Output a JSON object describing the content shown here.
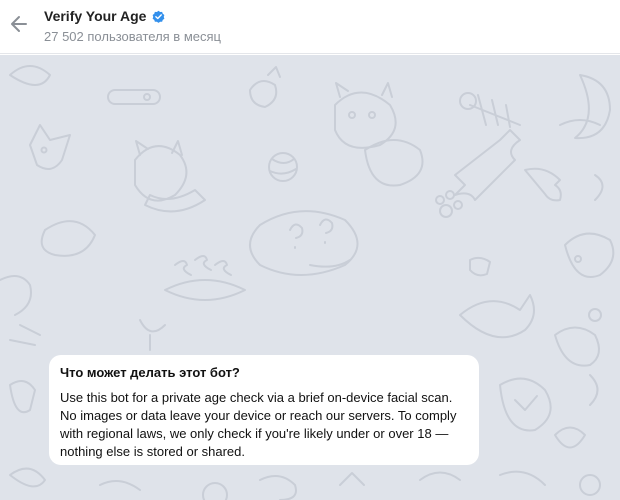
{
  "header": {
    "title": "Verify Your Age",
    "subtitle": "27 502 пользователя в месяц",
    "back_icon": "arrow-left-icon",
    "verified_icon": "verified-badge-icon",
    "accent_color": "#3390ec"
  },
  "chat": {
    "background_color": "#dfe3ea",
    "pattern_color": "#c3c9d3",
    "info_card": {
      "title": "Что может делать этот бот?",
      "description": "Use this bot for a private age check via a brief on-device facial scan. No images or data leave your device or reach our servers. To comply with regional laws, we only check if you're likely under or over 18 — nothing else is stored or shared."
    }
  }
}
